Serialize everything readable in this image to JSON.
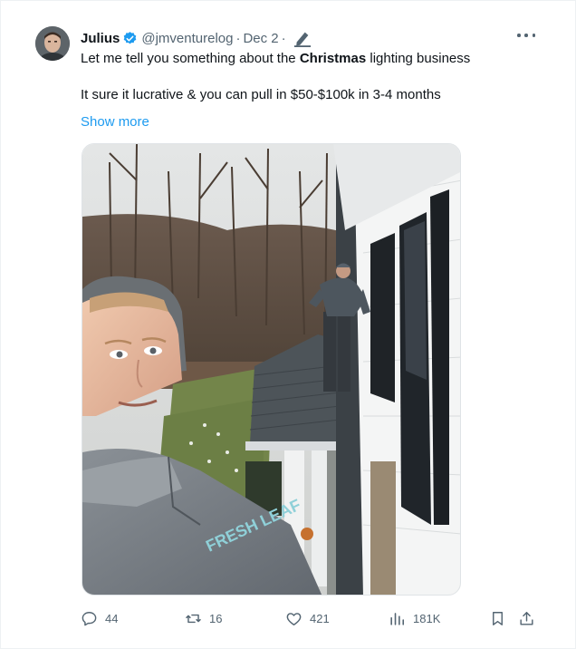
{
  "tweet": {
    "author_name": "Julius",
    "handle": "@jmventurelog",
    "separator": "·",
    "date": "Dec 2",
    "text_before": "Let me tell you something about the ",
    "text_bold": "Christmas",
    "text_after": " lighting business",
    "text_line2": "It sure it lucrative & you can pull in $50-$100k in 3-4 months",
    "show_more": "Show more",
    "media_hoodie_text": "FRESH LEAF"
  },
  "actions": {
    "replies": "44",
    "reposts": "16",
    "likes": "421",
    "views": "181K"
  },
  "icons": [
    "verified-badge-icon",
    "edit-pen-icon",
    "more-options-icon",
    "reply-icon",
    "repost-icon",
    "like-icon",
    "views-icon",
    "bookmark-icon",
    "share-icon"
  ],
  "colors": {
    "accent": "#1d9bf0",
    "muted": "#536471",
    "text": "#0f1419"
  }
}
